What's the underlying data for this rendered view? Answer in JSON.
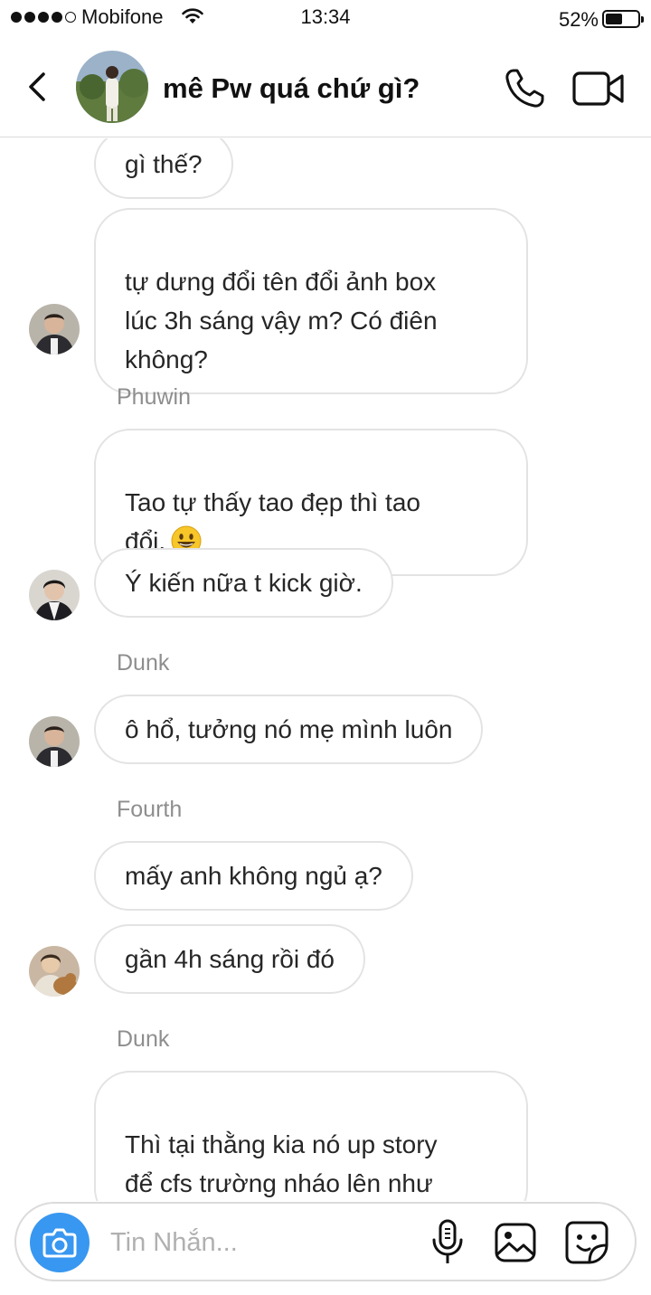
{
  "status_bar": {
    "carrier": "Mobifone",
    "time": "13:34",
    "battery_percent": "52%",
    "battery_level": 0.52,
    "signal_bars_filled": 4,
    "signal_bars_total": 5
  },
  "header": {
    "title": "mê Pw quá chứ gì?",
    "icons": [
      "back-icon",
      "phone-icon",
      "video-camera-icon"
    ]
  },
  "messages": [
    {
      "text": "gì thế?"
    },
    {
      "text": "tự dưng đổi tên đổi ảnh box\nlúc 3h sáng vậy m? Có điên\nkhông?"
    },
    {
      "sender": "Phuwin"
    },
    {
      "text": "Tao tự thấy tao đẹp thì tao\nđổi.",
      "emoji": "smiling-face-emoji"
    },
    {
      "text": "Ý kiến nữa t kick giờ."
    },
    {
      "sender": "Dunk"
    },
    {
      "text": "ô hổ, tưởng nó mẹ mình luôn"
    },
    {
      "sender": "Fourth"
    },
    {
      "text": "mấy anh không ngủ ạ?"
    },
    {
      "text": "gần 4h sáng rồi đó"
    },
    {
      "sender": "Dunk"
    },
    {
      "text": "Thì tại thằng kia nó up story\nđể cfs trường nháo lên như\nnhuộm kia kìa"
    }
  ],
  "composer": {
    "placeholder": "Tin Nhắn...",
    "icons": [
      "camera-icon",
      "microphone-icon",
      "gallery-icon",
      "sticker-icon"
    ]
  },
  "colors": {
    "accent": "#3897f0",
    "bubble_border": "#e3e3e3",
    "sender_name": "#8e8e8e",
    "divider": "#dbdbdb"
  }
}
